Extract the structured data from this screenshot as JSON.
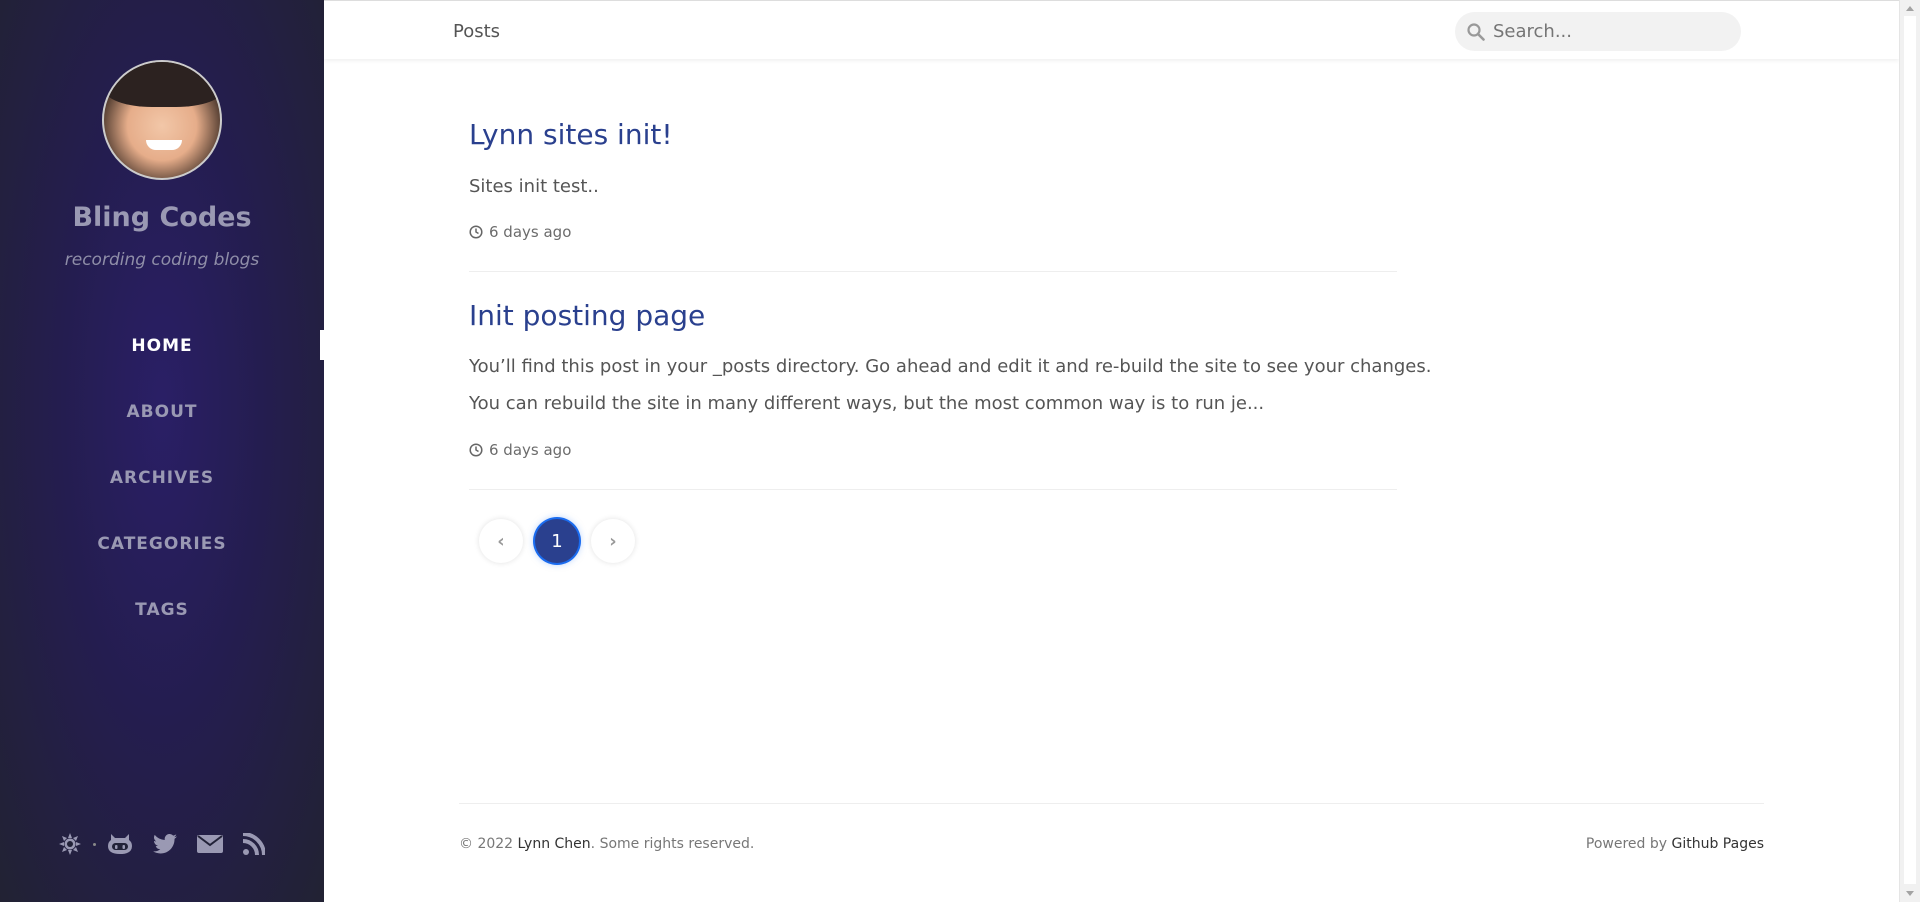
{
  "sidebar": {
    "title": "Bling Codes",
    "subtitle": "recording coding blogs",
    "nav": [
      {
        "label": "HOME",
        "active": true
      },
      {
        "label": "ABOUT"
      },
      {
        "label": "ARCHIVES"
      },
      {
        "label": "CATEGORIES"
      },
      {
        "label": "TAGS"
      }
    ],
    "icons": [
      "theme-toggle-icon",
      "github-icon",
      "twitter-icon",
      "email-icon",
      "rss-icon"
    ]
  },
  "topbar": {
    "breadcrumb": "Posts",
    "search_placeholder": "Search..."
  },
  "posts": [
    {
      "title": "Lynn sites init!",
      "excerpt": [
        "Sites init test.."
      ],
      "date": "6 days ago"
    },
    {
      "title": "Init posting page",
      "excerpt": [
        "You’ll find this post in your _posts directory. Go ahead and edit it and re-build the site to see your changes.",
        "You can rebuild the site in many different ways, but the most common way is to run je..."
      ],
      "date": "6 days ago"
    }
  ],
  "pagination": {
    "current": "1",
    "prev": "‹",
    "next": "›"
  },
  "footer": {
    "copyright_prefix": "© 2022 ",
    "author": "Lynn Chen",
    "copyright_suffix": ". Some rights reserved.",
    "powered_prefix": "Powered by ",
    "powered_link": "Github Pages"
  },
  "colors": {
    "accent": "#2a408e",
    "sidebar": "#241d4f"
  }
}
